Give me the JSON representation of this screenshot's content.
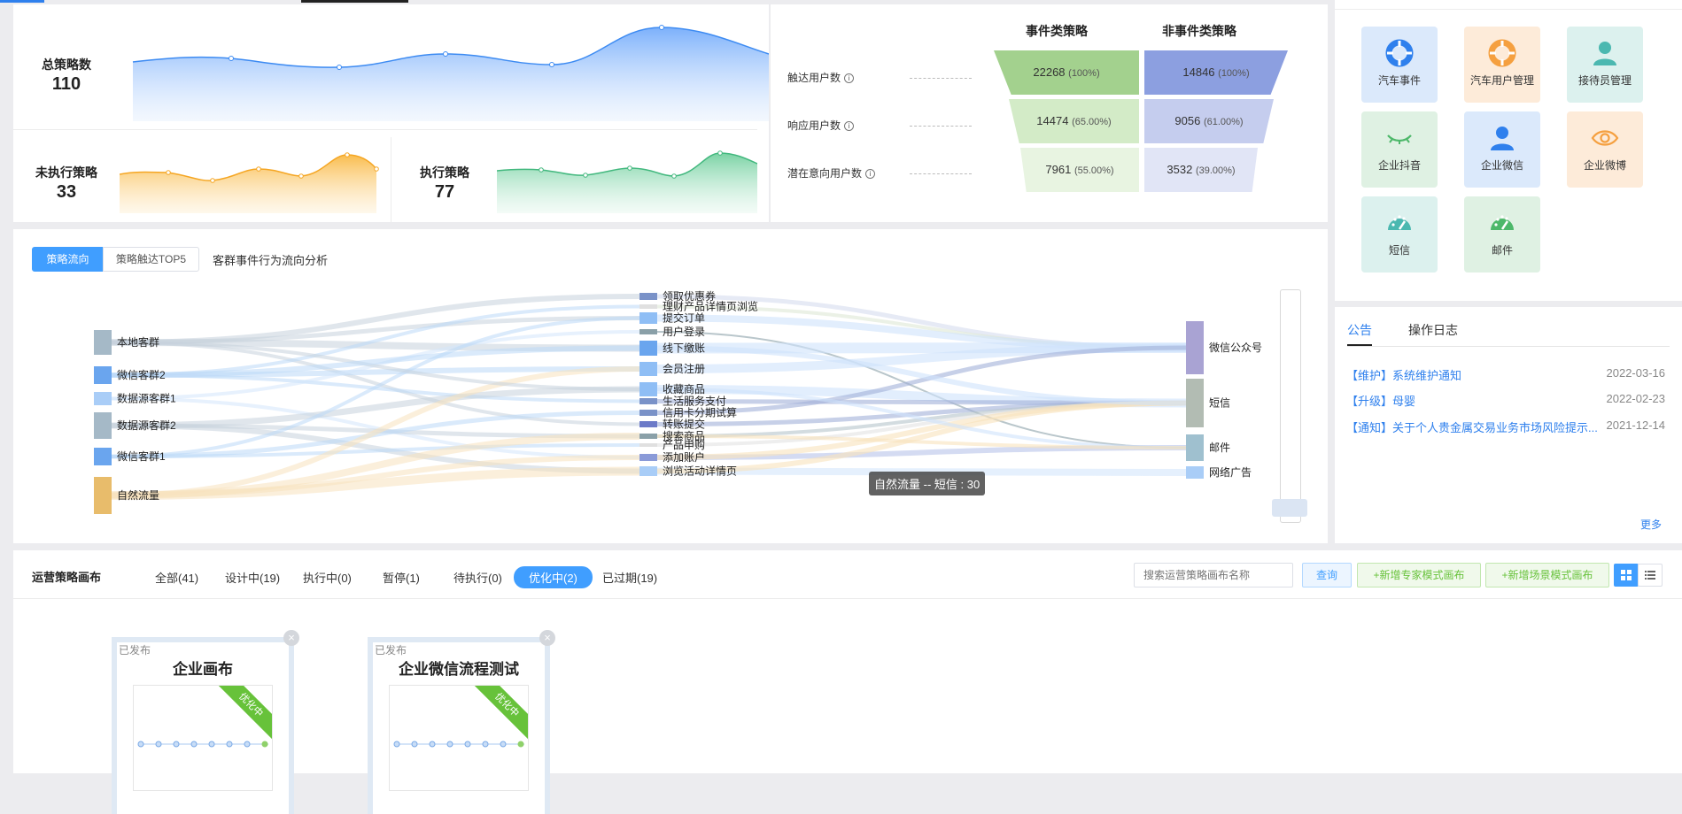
{
  "metrics": {
    "total": {
      "label": "总策略数",
      "value": "110"
    },
    "unexecuted": {
      "label": "未执行策略",
      "value": "33"
    },
    "executed": {
      "label": "执行策略",
      "value": "77"
    }
  },
  "funnel": {
    "col1": "事件类策略",
    "col2": "非事件类策略",
    "info_icon": "i",
    "rows": [
      {
        "label": "触达用户数",
        "v1": "22268",
        "p1": "(100%)",
        "v2": "14846",
        "p2": "(100%)"
      },
      {
        "label": "响应用户数",
        "v1": "14474",
        "p1": "(65.00%)",
        "v2": "9056",
        "p2": "(61.00%)"
      },
      {
        "label": "潜在意向用户数",
        "v1": "7961",
        "p1": "(55.00%)",
        "v2": "3532",
        "p2": "(39.00%)"
      }
    ]
  },
  "channels": [
    {
      "label": "汽车事件",
      "icon": "lifebuoy-icon",
      "color": "#2f80ed"
    },
    {
      "label": "汽车用户管理",
      "icon": "lifebuoy-icon",
      "color": "#f5a040"
    },
    {
      "label": "接待员管理",
      "icon": "person-icon",
      "color": "#4bb8b0"
    },
    {
      "label": "企业抖音",
      "icon": "closed-eye-icon",
      "color": "#4db86a"
    },
    {
      "label": "企业微信",
      "icon": "person-icon",
      "color": "#2f80ed"
    },
    {
      "label": "企业微博",
      "icon": "eye-icon",
      "color": "#f5a040"
    },
    {
      "label": "短信",
      "icon": "gauge-icon",
      "color": "#4bb8b0"
    },
    {
      "label": "邮件",
      "icon": "gauge-icon",
      "color": "#4db86a"
    }
  ],
  "flow": {
    "tab_active": "策略流向",
    "tab_other": "策略触达TOP5",
    "title": "客群事件行为流向分析",
    "sources": [
      "本地客群",
      "微信客群2",
      "数据源客群1",
      "数据源客群2",
      "微信客群1",
      "自然流量"
    ],
    "events": [
      "领取优惠券",
      "理财产品详情页浏览",
      "提交订单",
      "用户登录",
      "线下缴账",
      "会员注册",
      "收藏商品",
      "生活服务支付",
      "信用卡分期试算",
      "转账提交",
      "搜索商品",
      "产品申购",
      "添加账户",
      "浏览活动详情页"
    ],
    "targets": [
      "微信公众号",
      "短信",
      "邮件",
      "网络广告"
    ],
    "tooltip": "自然流量 -- 短信 : 30"
  },
  "announcements": {
    "tab_active": "公告",
    "tab_other": "操作日志",
    "items": [
      {
        "text": "【维护】系统维护通知",
        "date": "2022-03-16"
      },
      {
        "text": "【升级】母婴",
        "date": "2022-02-23"
      },
      {
        "text": "【通知】关于个人贵金属交易业务市场风险提示...",
        "date": "2021-12-14"
      }
    ],
    "more": "更多"
  },
  "canvas": {
    "title": "运营策略画布",
    "filters": [
      "全部(41)",
      "设计中(19)",
      "执行中(0)",
      "暂停(1)",
      "待执行(0)",
      "优化中(2)",
      "已过期(19)"
    ],
    "search_placeholder": "搜索运营策略画布名称",
    "query": "查询",
    "add_expert": "+新增专家模式画布",
    "add_scene": "+新增场景模式画布",
    "cards": [
      {
        "status": "已发布",
        "title": "企业画布",
        "ribbon": "优化中"
      },
      {
        "status": "已发布",
        "title": "企业微信流程测试",
        "ribbon": "优化中"
      }
    ]
  }
}
